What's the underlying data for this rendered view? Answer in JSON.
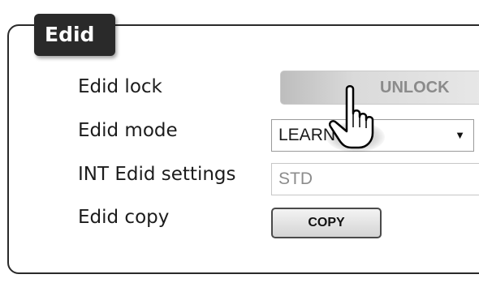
{
  "panel": {
    "title": "Edid"
  },
  "rows": [
    {
      "label": "Edid lock"
    },
    {
      "label": "Edid mode"
    },
    {
      "label": "INT Edid settings"
    },
    {
      "label": "Edid copy"
    }
  ],
  "controls": {
    "lock_button_label": "UNLOCK",
    "mode_select_value": "LEARN",
    "int_settings_value": "STD",
    "copy_button_label": "COPY"
  },
  "icons": {
    "select_arrow": "dropdown-arrow-icon",
    "pointer": "hand-pointer-icon"
  },
  "colors": {
    "panel_border": "#2a2a2a",
    "tab_background": "#2a2a2a",
    "tab_text": "#ffffff",
    "disabled_text": "#8b8b8b"
  }
}
